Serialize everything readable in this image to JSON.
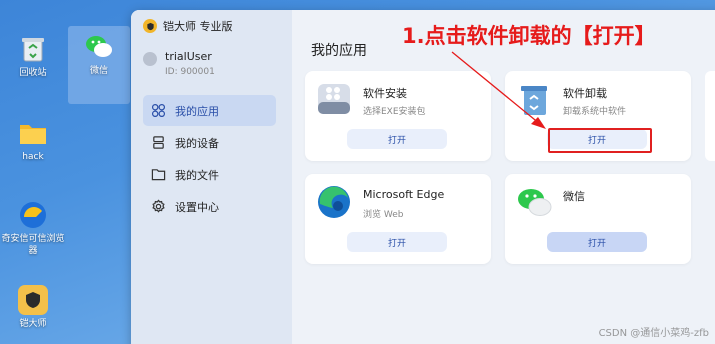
{
  "desktop": {
    "icons": [
      {
        "label": "回收站",
        "icon": "recycle-bin-icon"
      },
      {
        "label": "微信",
        "icon": "wechat-icon"
      },
      {
        "label": "hack",
        "icon": "folder-icon"
      },
      {
        "label": "奇安信可信浏览器",
        "icon": "browser-icon"
      },
      {
        "label": "铠大师",
        "icon": "kaidashi-icon"
      }
    ]
  },
  "app": {
    "brand": "铠大师 专业版",
    "user": {
      "name": "trialUser",
      "id": "ID: 900001"
    },
    "nav": [
      {
        "label": "我的应用",
        "icon": "apps-icon",
        "active": true
      },
      {
        "label": "我的设备",
        "icon": "device-icon",
        "active": false
      },
      {
        "label": "我的文件",
        "icon": "folder-icon",
        "active": false
      },
      {
        "label": "设置中心",
        "icon": "gear-icon",
        "active": false
      }
    ],
    "section_title": "我的应用",
    "cards": [
      {
        "title": "软件安装",
        "subtitle": "选择EXE安装包",
        "button": "打开",
        "icon": "installer-icon"
      },
      {
        "title": "软件卸载",
        "subtitle": "卸载系统中软件",
        "button": "打开",
        "icon": "uninstall-icon"
      },
      {
        "title": "Microsoft Edge",
        "subtitle": "浏览 Web",
        "button": "打开",
        "icon": "edge-icon"
      },
      {
        "title": "微信",
        "subtitle": "",
        "button": "打开",
        "icon": "wechat-icon"
      }
    ]
  },
  "annotation": {
    "text": "1.点击软件卸载的【打开】",
    "color": "#e61b1b"
  },
  "watermark": "CSDN @通信小菜鸡-zfb",
  "colors": {
    "accent": "#2a4fa8",
    "highlight": "#e02020"
  }
}
